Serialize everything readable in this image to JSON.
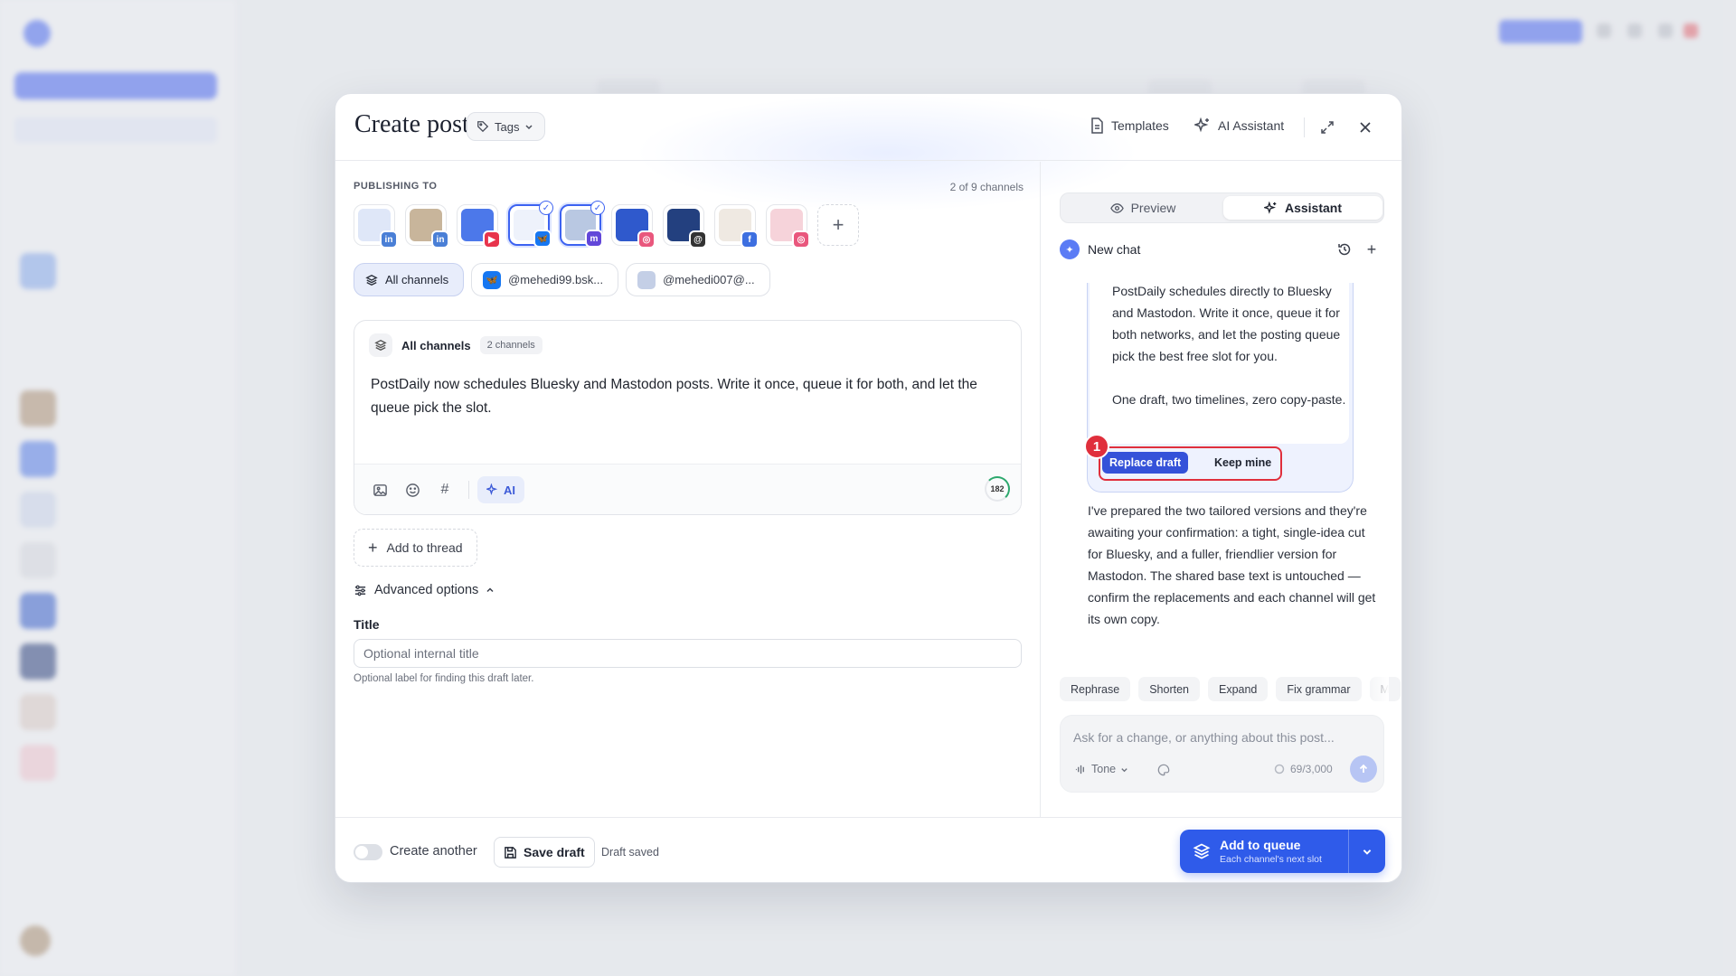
{
  "modal": {
    "title": "Create post",
    "tags_label": "Tags",
    "templates_label": "Templates",
    "ai_assistant_label": "AI Assistant"
  },
  "publishing": {
    "label": "PUBLISHING TO",
    "count": "2 of 9 channels",
    "accounts": [
      {
        "network": "linkedin",
        "selected": false,
        "color": "#3d7be0"
      },
      {
        "network": "linkedin",
        "selected": false,
        "color": "#b49a7a"
      },
      {
        "network": "youtube",
        "selected": false,
        "color": "#3a6be8"
      },
      {
        "network": "bluesky",
        "selected": true,
        "color": "#e9eef8"
      },
      {
        "network": "mastodon",
        "selected": true,
        "color": "#9fb3d6"
      },
      {
        "network": "instagram",
        "selected": false,
        "color": "#2c56c8"
      },
      {
        "network": "threads",
        "selected": false,
        "color": "#1e3a7a"
      },
      {
        "network": "facebook",
        "selected": false,
        "color": "#e8e2da"
      },
      {
        "network": "instagram",
        "selected": false,
        "color": "#f1c6cf"
      }
    ],
    "chips": [
      "All channels",
      "@mehedi99.bsk...",
      "@mehedi007@..."
    ]
  },
  "editor": {
    "header_label": "All channels",
    "channel_count": "2 channels",
    "text": "PostDaily now schedules Bluesky and Mastodon posts. Write it once, queue it for both, and let the queue pick the slot.",
    "ai_label": "AI",
    "char_remaining": "182"
  },
  "thread_label": "Add to thread",
  "advanced": {
    "label": "Advanced options",
    "title_label": "Title",
    "title_placeholder": "Optional internal title",
    "title_help": "Optional label for finding this draft later."
  },
  "assistant": {
    "tabs": [
      "Preview",
      "Assistant"
    ],
    "chat_title": "New chat",
    "suggestion_paragraphs": [
      "PostDaily schedules directly to Bluesky and Mastodon. Write it once, queue it for both networks, and let the posting queue pick the best free slot for you.",
      "One draft, two timelines, zero copy-paste."
    ],
    "step_number": "1",
    "replace_label": "Replace draft",
    "keep_label": "Keep mine",
    "reply": "I've prepared the two tailored versions and they're awaiting your confirmation: a tight, single-idea cut for Bluesky, and a fuller, friendlier version for Mastodon. The shared base text is untouched — confirm the replacements and each channel will get its own copy.",
    "quick_actions": [
      "Rephrase",
      "Shorten",
      "Expand",
      "Fix grammar"
    ],
    "input_placeholder": "Ask for a change, or anything about this post...",
    "tone_label": "Tone",
    "char_count": "69/3,000"
  },
  "footer": {
    "create_another": "Create another",
    "save_draft": "Save draft",
    "draft_status": "Draft saved",
    "queue_label": "Add to queue",
    "queue_sub": "Each channel's next slot"
  },
  "colors": {
    "accent": "#2f5bea",
    "highlight": "#e02f3c"
  }
}
